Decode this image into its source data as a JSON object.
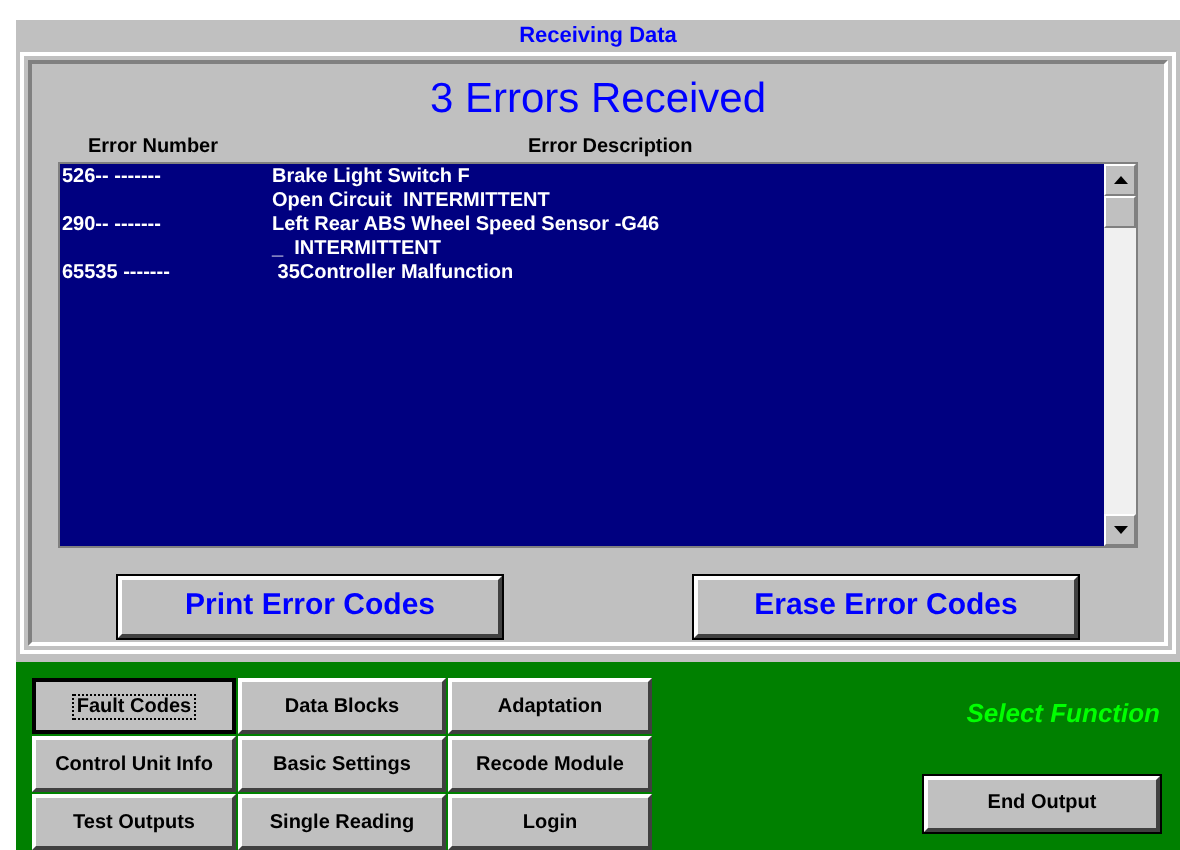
{
  "window": {
    "title": "Receiving Data"
  },
  "heading": "3 Errors Received",
  "table": {
    "columns": [
      "Error Number",
      "Error Description"
    ],
    "rows": [
      {
        "number": "526-- -------",
        "description": [
          "Brake Light Switch F",
          "Open Circuit  INTERMITTENT"
        ]
      },
      {
        "number": "290-- -------",
        "description": [
          "Left Rear ABS Wheel Speed Sensor -G46",
          "_  INTERMITTENT"
        ]
      },
      {
        "number": "65535 -------",
        "description": [
          " 35Controller Malfunction"
        ]
      }
    ]
  },
  "actions": [
    "Print Error Codes",
    "Erase Error Codes"
  ],
  "functions": [
    {
      "label": "Fault Codes",
      "selected": true
    },
    {
      "label": "Data Blocks",
      "selected": false
    },
    {
      "label": "Adaptation",
      "selected": false
    },
    {
      "label": "Control Unit Info",
      "selected": false
    },
    {
      "label": "Basic Settings",
      "selected": false
    },
    {
      "label": "Recode Module",
      "selected": false
    },
    {
      "label": "Test Outputs",
      "selected": false
    },
    {
      "label": "Single Reading",
      "selected": false
    },
    {
      "label": "Login",
      "selected": false
    }
  ],
  "prompt": "Select Function",
  "end_button": "End Output"
}
